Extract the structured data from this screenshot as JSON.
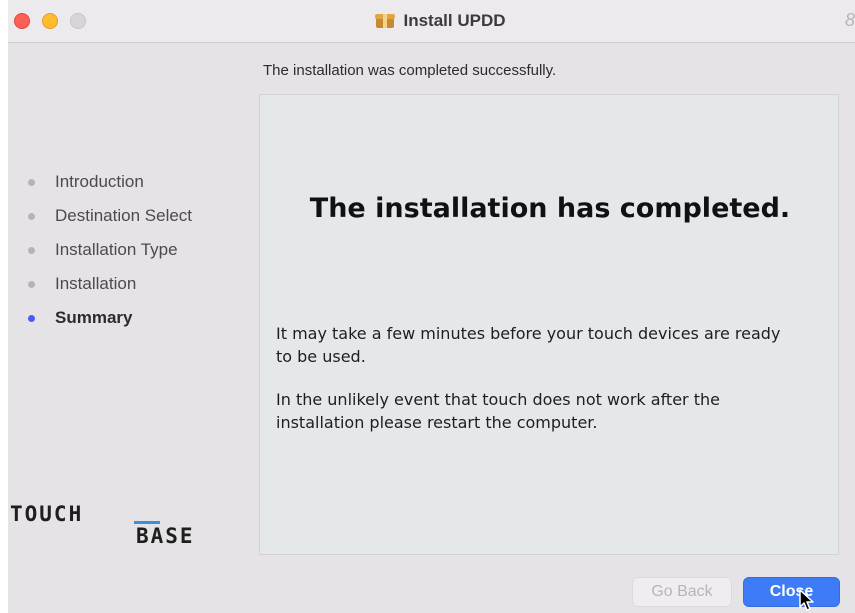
{
  "window": {
    "title": "Install UPDD",
    "title_edge_glyph": "8"
  },
  "sidebar": {
    "steps": [
      {
        "label": "Introduction",
        "active": false
      },
      {
        "label": "Destination Select",
        "active": false
      },
      {
        "label": "Installation Type",
        "active": false
      },
      {
        "label": "Installation",
        "active": false
      },
      {
        "label": "Summary",
        "active": true
      }
    ],
    "logo": {
      "top_text": "TOUCH",
      "bottom_text": "BASE",
      "accent_color": "#3b8fd6"
    }
  },
  "main": {
    "subtitle": "The installation was completed successfully.",
    "heading": "The installation has completed.",
    "paragraphs": [
      "It may take a few minutes before your touch devices are ready to be used.",
      "In the unlikely event that touch does not work after the installation please restart the computer."
    ]
  },
  "footer": {
    "back_label": "Go Back",
    "close_label": "Close"
  },
  "colors": {
    "accent": "#3e7bf6",
    "active_step_dot": "#4a5cf0",
    "close_light": "#fe5f57",
    "minimize_light": "#febc2e"
  },
  "icons": {
    "title_icon": "package-icon",
    "pointer": "cursor-arrow-icon"
  }
}
